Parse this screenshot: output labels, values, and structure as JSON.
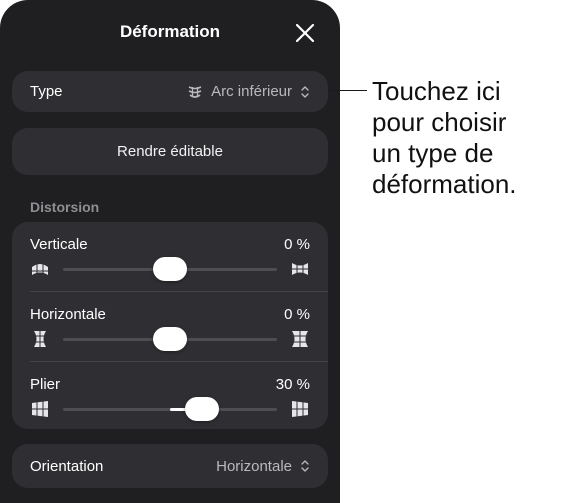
{
  "panel": {
    "title": "Déformation",
    "close_icon": "close-icon"
  },
  "type_row": {
    "label": "Type",
    "value": "Arc inférieur",
    "icon": "arc-warp-icon",
    "chevron": "up-down-chevron-icon"
  },
  "editable_button": {
    "label": "Rendre éditable"
  },
  "distortion": {
    "section_title": "Distorsion",
    "sliders": [
      {
        "label": "Verticale",
        "percent": "0 %",
        "value": 0,
        "icon_left": "vertical-compress-icon",
        "icon_right": "vertical-expand-icon"
      },
      {
        "label": "Horizontale",
        "percent": "0 %",
        "value": 0,
        "icon_left": "horizontal-compress-icon",
        "icon_right": "horizontal-expand-icon"
      },
      {
        "label": "Plier",
        "percent": "30 %",
        "value": 30,
        "icon_left": "bend-left-icon",
        "icon_right": "bend-right-icon"
      }
    ]
  },
  "orientation_row": {
    "label": "Orientation",
    "value": "Horizontale",
    "chevron": "up-down-chevron-icon"
  },
  "callout": {
    "lines": [
      "Touchez ici",
      "pour choisir",
      "un type de",
      "déformation."
    ]
  }
}
